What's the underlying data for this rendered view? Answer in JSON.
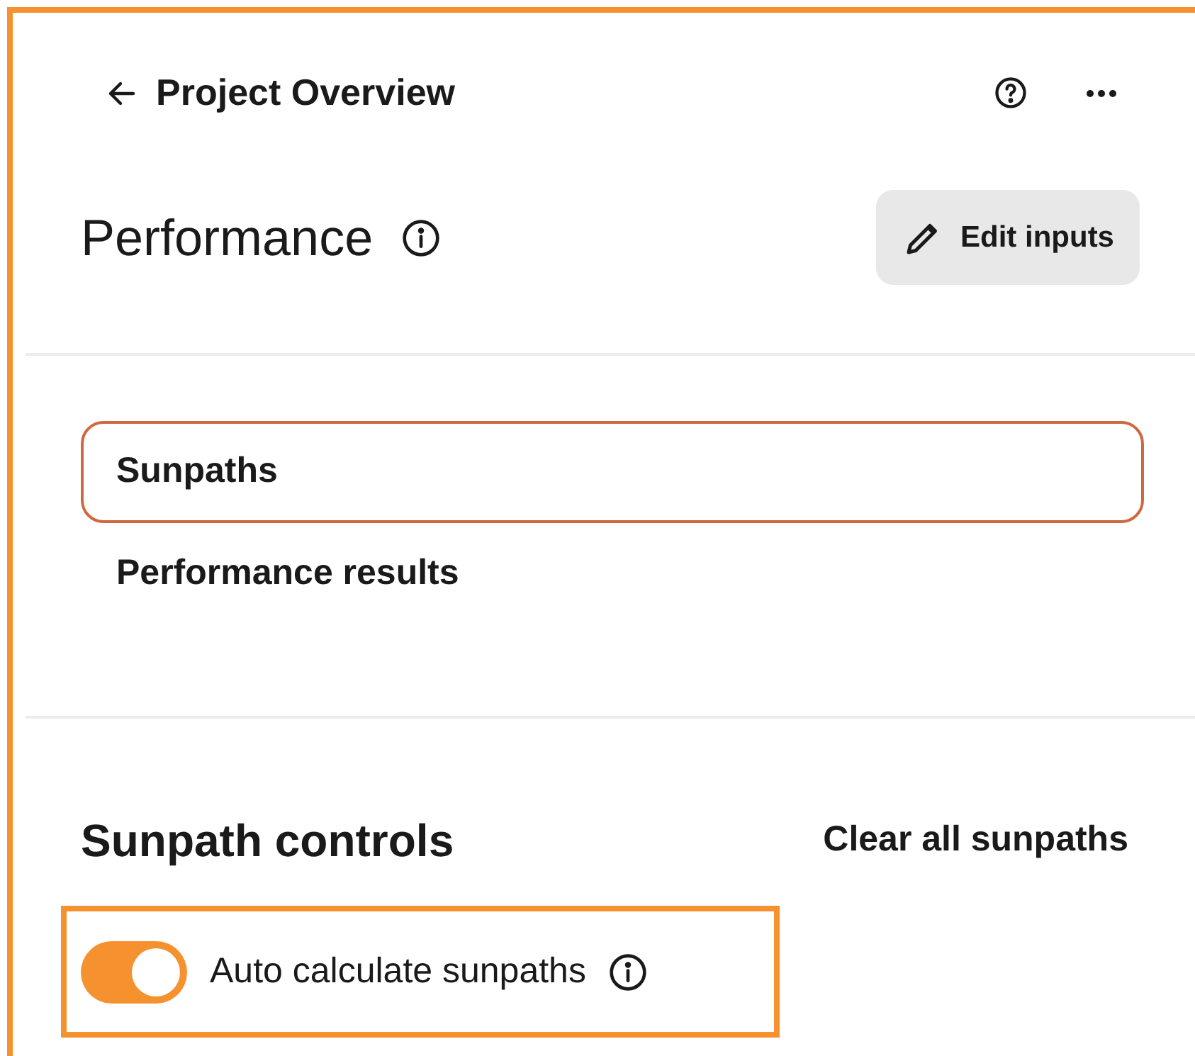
{
  "header": {
    "back_label": "Project Overview"
  },
  "title": "Performance",
  "edit_button": "Edit inputs",
  "tabs": [
    {
      "label": "Sunpaths",
      "selected": true
    },
    {
      "label": "Performance results",
      "selected": false
    }
  ],
  "controls": {
    "heading": "Sunpath controls",
    "clear_link": "Clear all sunpaths",
    "toggle": {
      "label": "Auto calculate sunpaths",
      "on": true
    }
  }
}
